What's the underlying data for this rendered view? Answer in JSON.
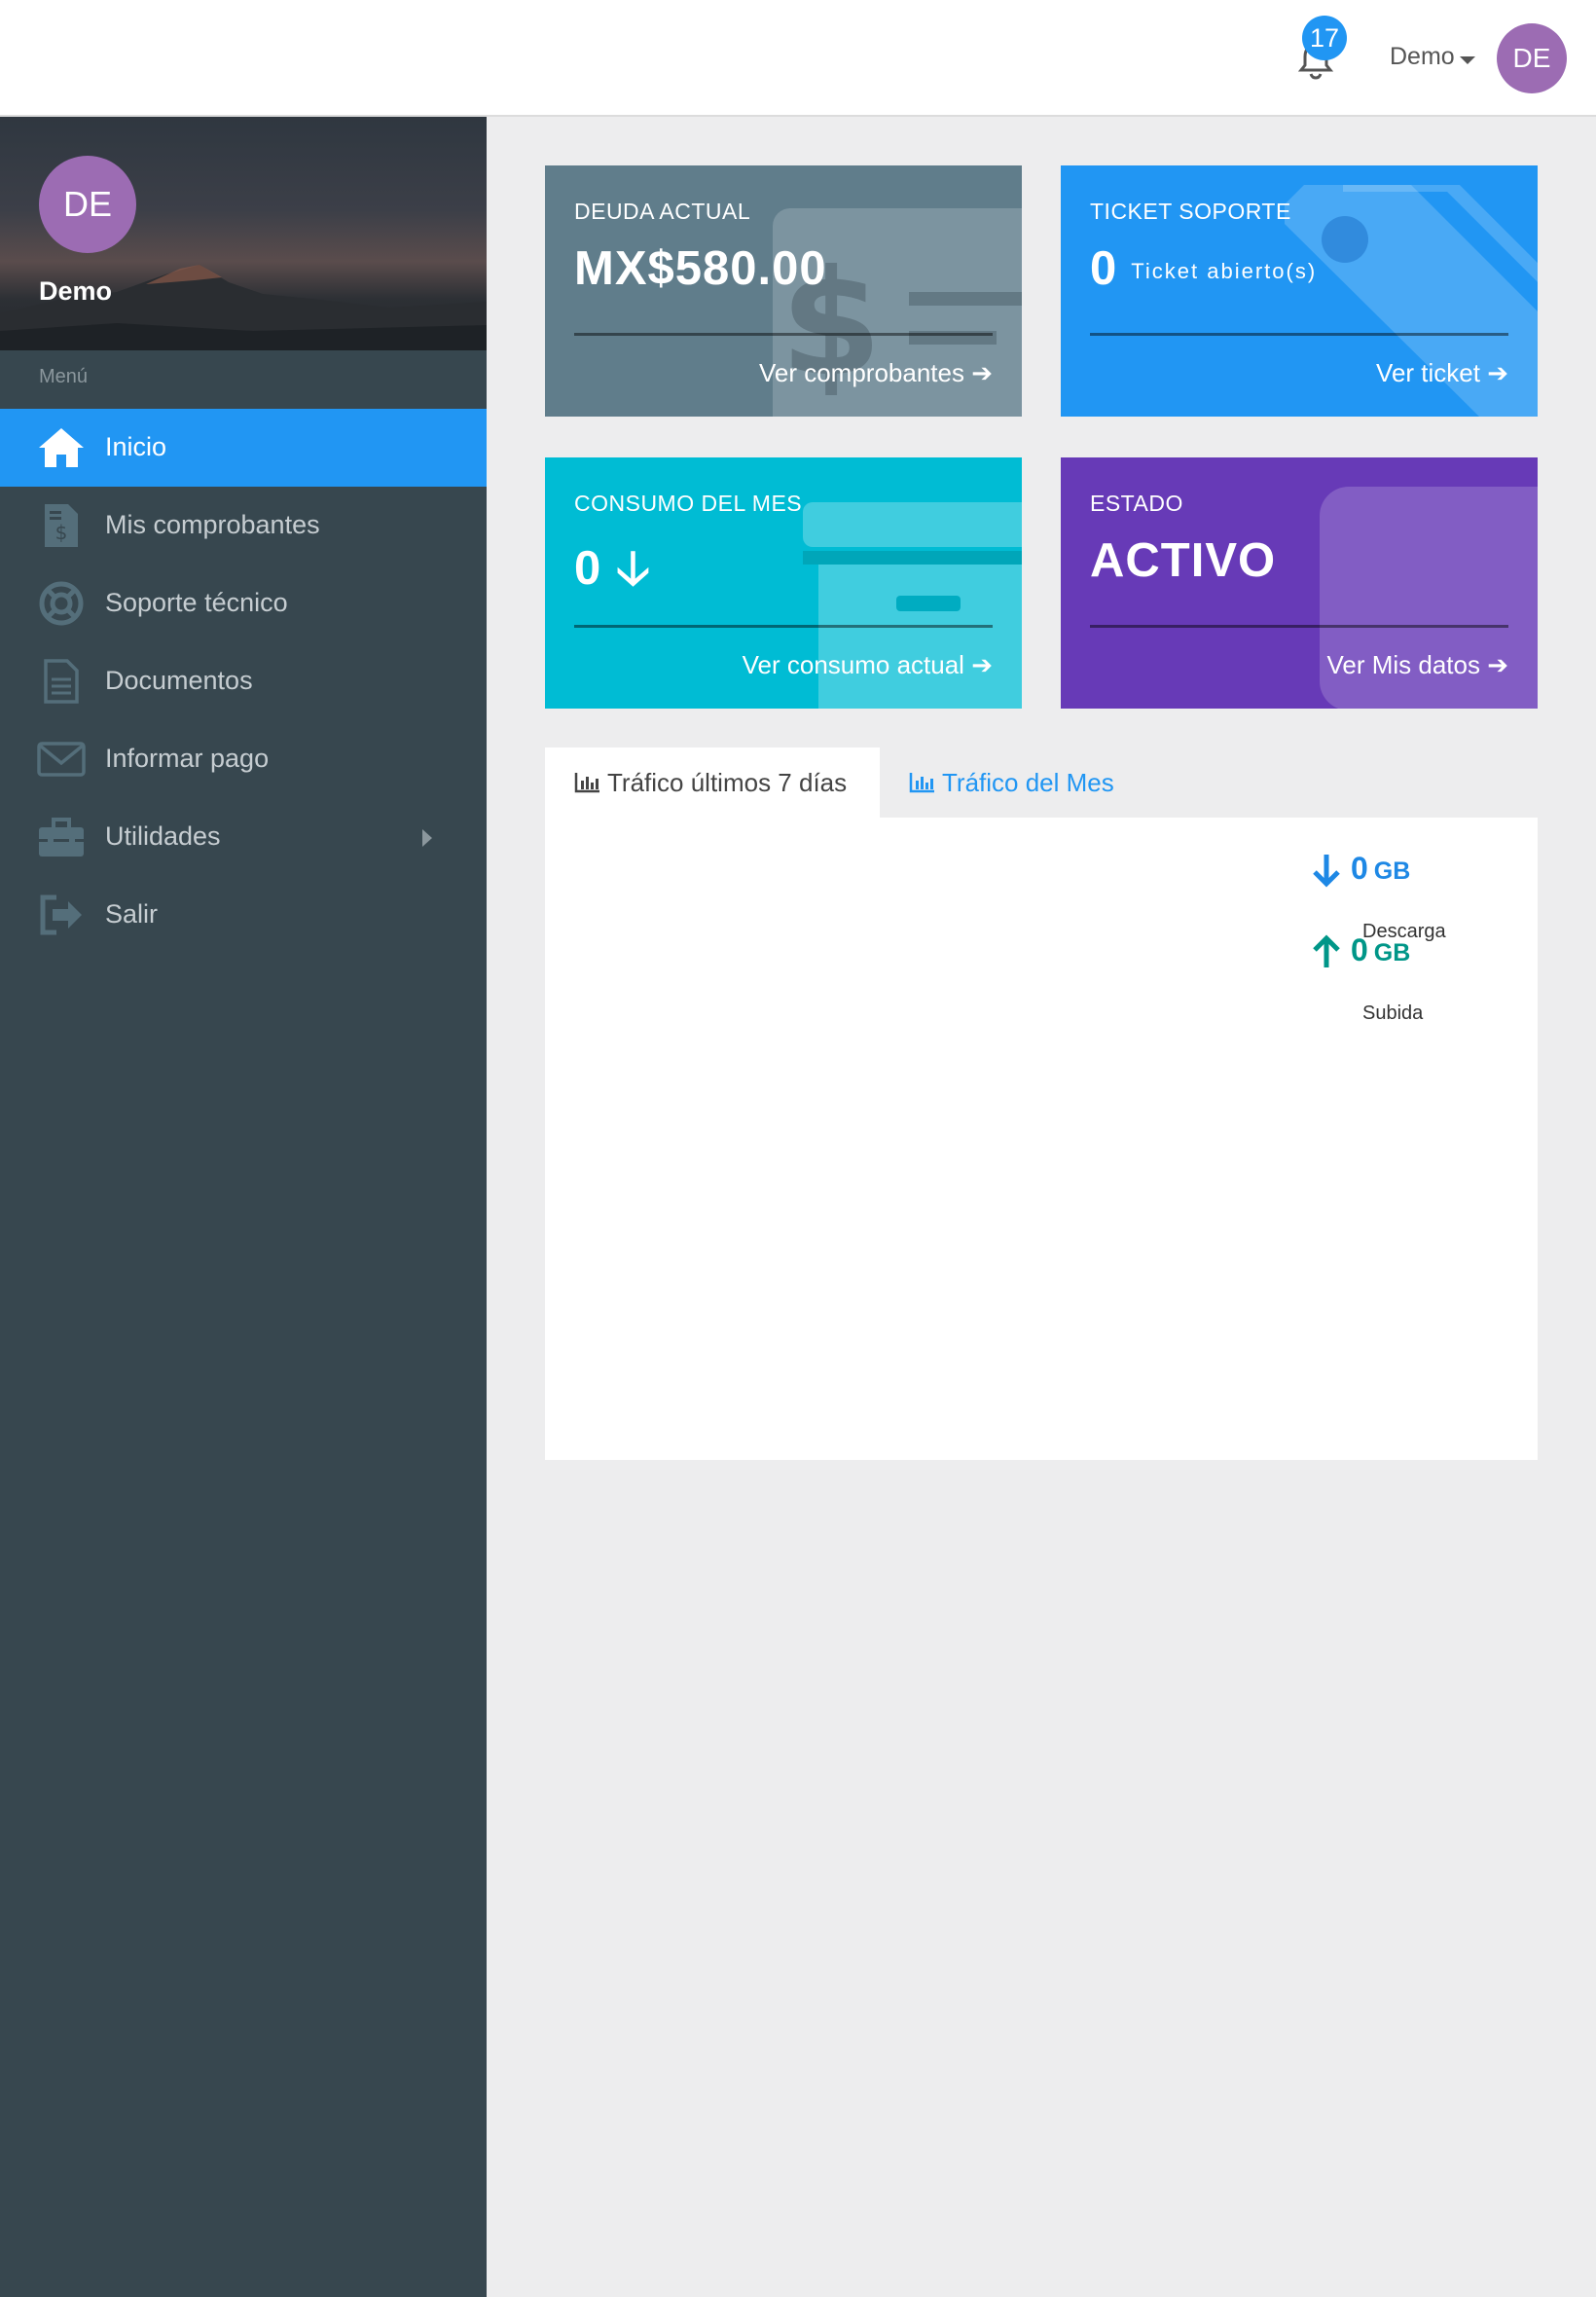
{
  "topbar": {
    "notifications_count": "17",
    "user_name": "Demo",
    "avatar_initials": "DE"
  },
  "sidebar": {
    "avatar_initials": "DE",
    "user_name": "Demo",
    "menu_title": "Menú",
    "items": [
      {
        "label": "Inicio",
        "icon": "home-icon",
        "active": true
      },
      {
        "label": "Mis comprobantes",
        "icon": "invoice-icon"
      },
      {
        "label": "Soporte técnico",
        "icon": "lifebuoy-icon"
      },
      {
        "label": "Documentos",
        "icon": "document-icon"
      },
      {
        "label": "Informar pago",
        "icon": "envelope-icon"
      },
      {
        "label": "Utilidades",
        "icon": "toolbox-icon",
        "has_submenu": true
      },
      {
        "label": "Salir",
        "icon": "sign-out-icon"
      }
    ]
  },
  "cards": [
    {
      "title": "DEUDA ACTUAL",
      "value": "MX$580.00",
      "link": "Ver comprobantes",
      "color": "#607d8b",
      "icon": "money-icon"
    },
    {
      "title": "TICKET SOPORTE",
      "value": "0",
      "sub": "Ticket abierto(s)",
      "link": "Ver ticket",
      "color": "#2196f3",
      "icon": "tag-icon"
    },
    {
      "title": "CONSUMO DEL MES",
      "value": "0",
      "link": "Ver consumo actual",
      "color": "#00bcd4",
      "icon": "credit-card-icon"
    },
    {
      "title": "ESTADO",
      "value": "ACTIVO",
      "link": "Ver Mis datos",
      "color": "#673ab7",
      "icon": "id-card-icon"
    }
  ],
  "tabs": [
    {
      "label": "Tráfico últimos 7 días",
      "active": true
    },
    {
      "label": "Tráfico del Mes",
      "active": false
    }
  ],
  "traffic": {
    "download": {
      "value": "0",
      "unit": "GB",
      "label": "Descarga",
      "color": "#1e88e5"
    },
    "upload": {
      "value": "0",
      "unit": "GB",
      "label": "Subida",
      "color": "#009688"
    }
  }
}
